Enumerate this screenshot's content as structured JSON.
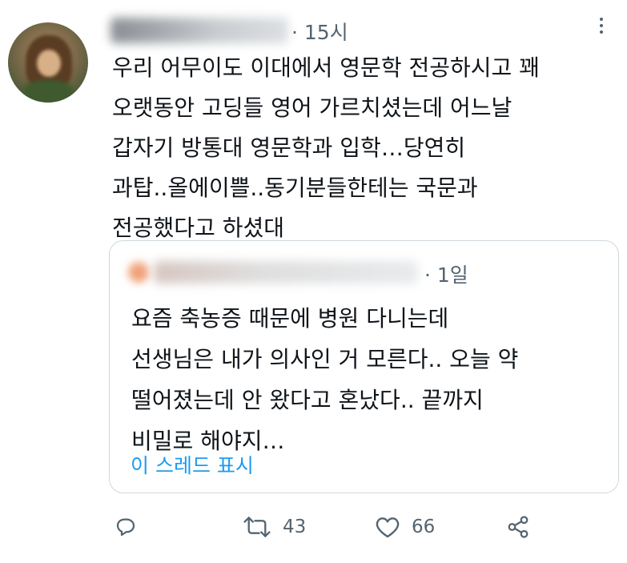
{
  "tweet": {
    "time": "· 15시",
    "text": "우리 어무이도 이대에서 영문학 전공하시고 꽤\n오랫동안 고딩들 영어 가르치셨는데 어느날\n갑자기 방통대 영문학과 입학…당연히\n과탑..올에이쁠..동기분들한테는 국문과\n전공했다고 하셨대"
  },
  "quoted": {
    "time": "· 1일",
    "text": "요즘 축농증 때문에 병원 다니는데\n선생님은 내가 의사인 거 모른다.. 오늘 약\n떨어졌는데 안 왔다고 혼났다.. 끝까지\n비밀로 해야지…",
    "show_thread": "이 스레드 표시"
  },
  "actions": {
    "reply_icon": "reply-icon",
    "retweet_icon": "retweet-icon",
    "retweets": "43",
    "like_icon": "heart-icon",
    "likes": "66",
    "share_icon": "share-icon"
  },
  "colors": {
    "text": "#0f1419",
    "secondary": "#536471",
    "link": "#1d9bf0",
    "border": "#cfd9de"
  }
}
